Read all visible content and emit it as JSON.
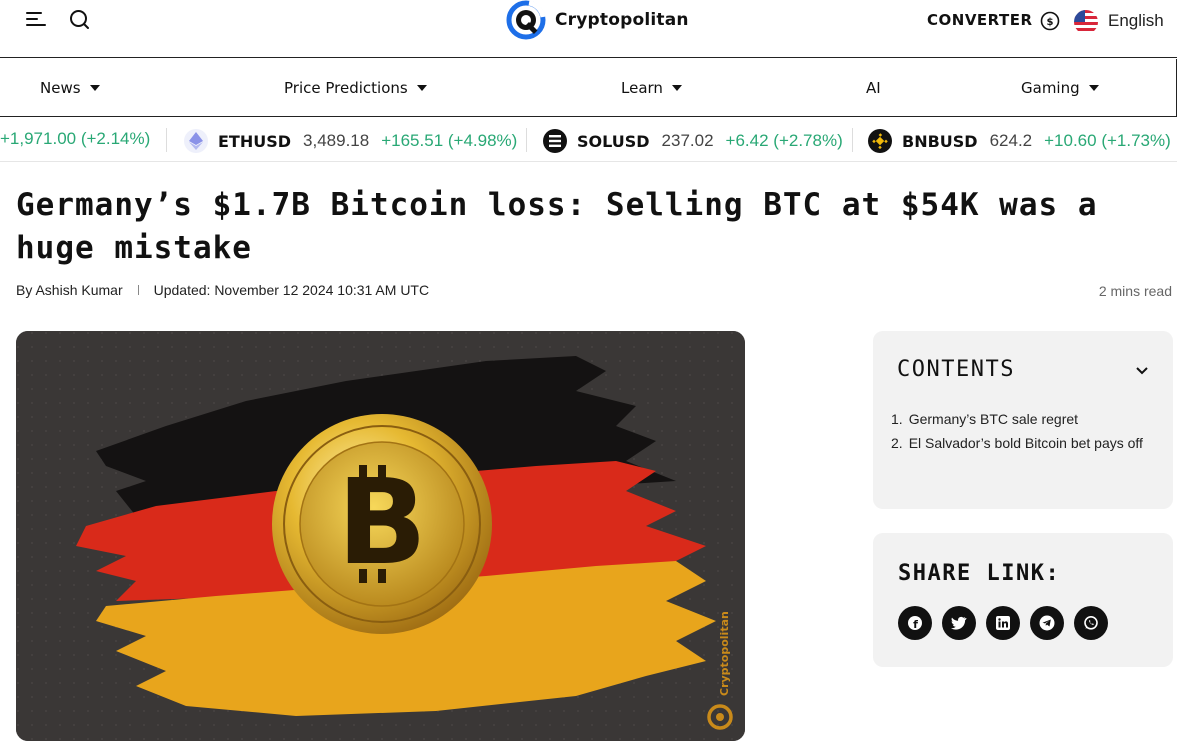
{
  "header": {
    "brand": "Cryptopolitan",
    "converter_label": "CONVERTER",
    "language": "English"
  },
  "nav": {
    "items": [
      {
        "label": "News",
        "dropdown": true
      },
      {
        "label": "Price Predictions",
        "dropdown": true
      },
      {
        "label": "Learn",
        "dropdown": true
      },
      {
        "label": "AI",
        "dropdown": false
      },
      {
        "label": "Gaming",
        "dropdown": true
      }
    ]
  },
  "ticker": [
    {
      "symbol": "",
      "price": "",
      "change": "+1,971.00 (+2.14%)",
      "icon": "partial"
    },
    {
      "symbol": "ETHUSD",
      "price": "3,489.18",
      "change": "+165.51 (+4.98%)",
      "icon": "ethereum-icon"
    },
    {
      "symbol": "SOLUSD",
      "price": "237.02",
      "change": "+6.42 (+2.78%)",
      "icon": "solana-icon"
    },
    {
      "symbol": "BNBUSD",
      "price": "624.2",
      "change": "+10.60 (+1.73%)",
      "icon": "bnb-icon"
    }
  ],
  "article": {
    "title": "Germany’s $1.7B Bitcoin loss: Selling BTC at $54K was a huge mistake",
    "author": "By Ashish Kumar",
    "updated": "Updated: November 12 2024 10:31 AM UTC",
    "read_time": "2 mins read",
    "image_watermark": "Cryptopolitan"
  },
  "contents": {
    "title": "CONTENTS",
    "items": [
      {
        "num": "1.",
        "text": "Germany’s BTC sale regret"
      },
      {
        "num": "2.",
        "text": "El Salvador’s bold Bitcoin bet pays off"
      }
    ]
  },
  "share": {
    "title": "SHARE LINK:",
    "icons": [
      "facebook-icon",
      "twitter-icon",
      "linkedin-icon",
      "telegram-icon",
      "whatsapp-icon"
    ]
  },
  "colors": {
    "positive_change": "#29a875",
    "brand_blue": "#1e6fe8",
    "panel_bg": "#f2f2f2"
  }
}
